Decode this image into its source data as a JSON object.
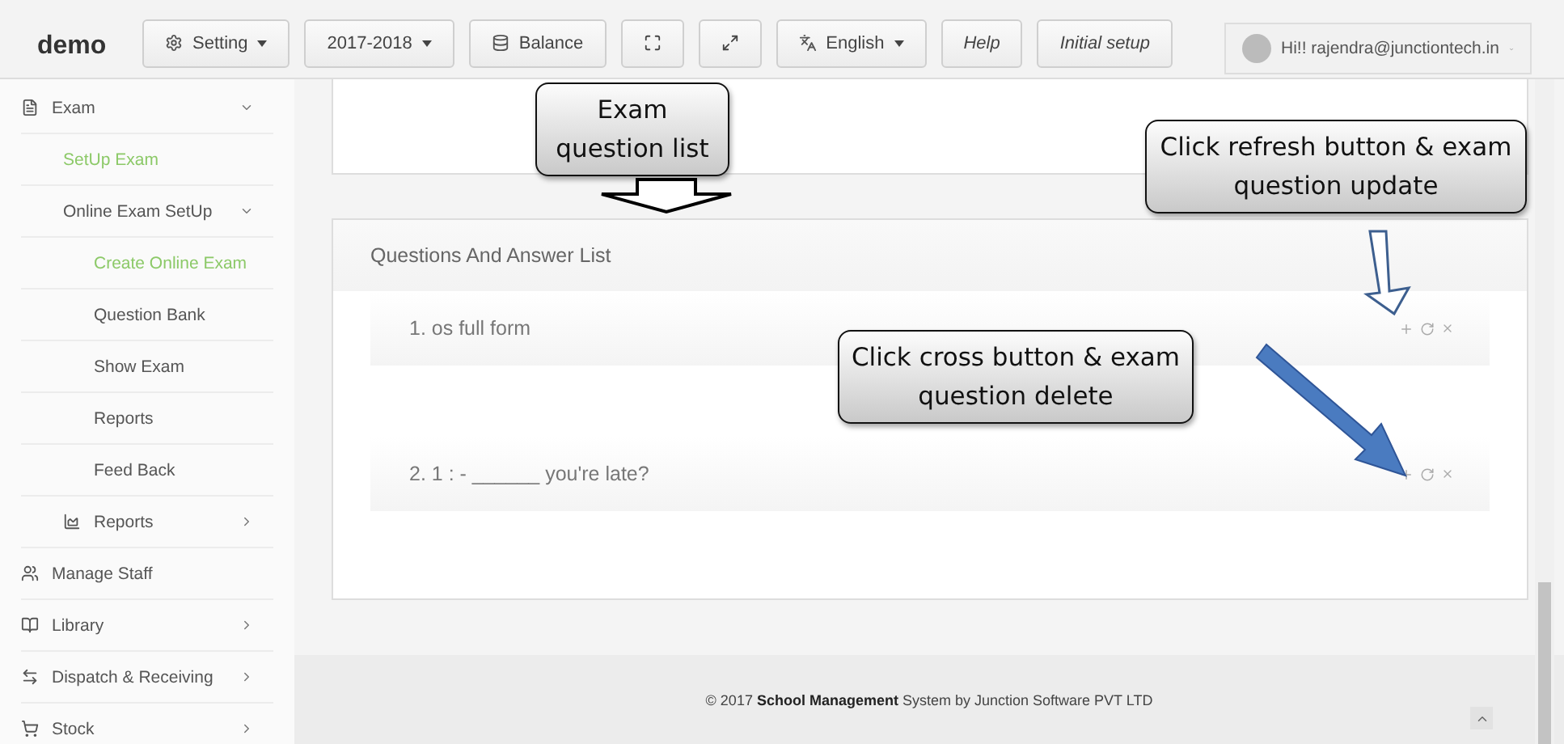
{
  "brand": "demo",
  "toolbar": [
    {
      "label": "Setting",
      "kind": "menu"
    },
    {
      "label": "2017-2018",
      "kind": "menu"
    },
    {
      "label": "Balance",
      "kind": "plain"
    },
    {
      "kind": "fullscreen"
    },
    {
      "kind": "resize"
    },
    {
      "label": "English",
      "kind": "menu"
    },
    {
      "label": "Help",
      "kind": "italic"
    },
    {
      "label": "Initial setup",
      "kind": "italic"
    }
  ],
  "user": {
    "label": "Hi!! rajendra@junctiontech.in"
  },
  "sidebar": {
    "items": [
      {
        "label": "Exam",
        "expanded": true,
        "selected": false,
        "children": [
          {
            "label": "SetUp Exam",
            "selected": true
          },
          {
            "label": "Online Exam SetUp",
            "expanded": true,
            "selected": false,
            "children": [
              {
                "label": "Create Online Exam",
                "selected": true
              },
              {
                "label": "Question Bank",
                "selected": false
              },
              {
                "label": "Show Exam",
                "selected": false
              },
              {
                "label": "Reports",
                "selected": false
              },
              {
                "label": "Feed Back",
                "selected": false
              }
            ]
          },
          {
            "label": "Reports",
            "expanded": false,
            "selected": false,
            "kind": "group"
          }
        ]
      },
      {
        "label": "Manage Staff",
        "selected": false
      },
      {
        "label": "Library",
        "expanded": false,
        "selected": false
      },
      {
        "label": "Dispatch & Receiving",
        "expanded": false,
        "selected": false
      },
      {
        "label": "Stock",
        "expanded": false,
        "selected": false
      }
    ]
  },
  "panel": {
    "title": "Questions And Answer List",
    "questions": [
      {
        "text": "1. os full form"
      },
      {
        "text": "2. 1 : - ______ you're late?"
      }
    ]
  },
  "callouts": [
    {
      "text": "Exam question list"
    },
    {
      "text": "Click refresh  button & exam question update"
    },
    {
      "text": "Click cross button & exam question delete"
    }
  ],
  "footer": "© 2017 **School Management** System by Junction Software PVT LTD"
}
